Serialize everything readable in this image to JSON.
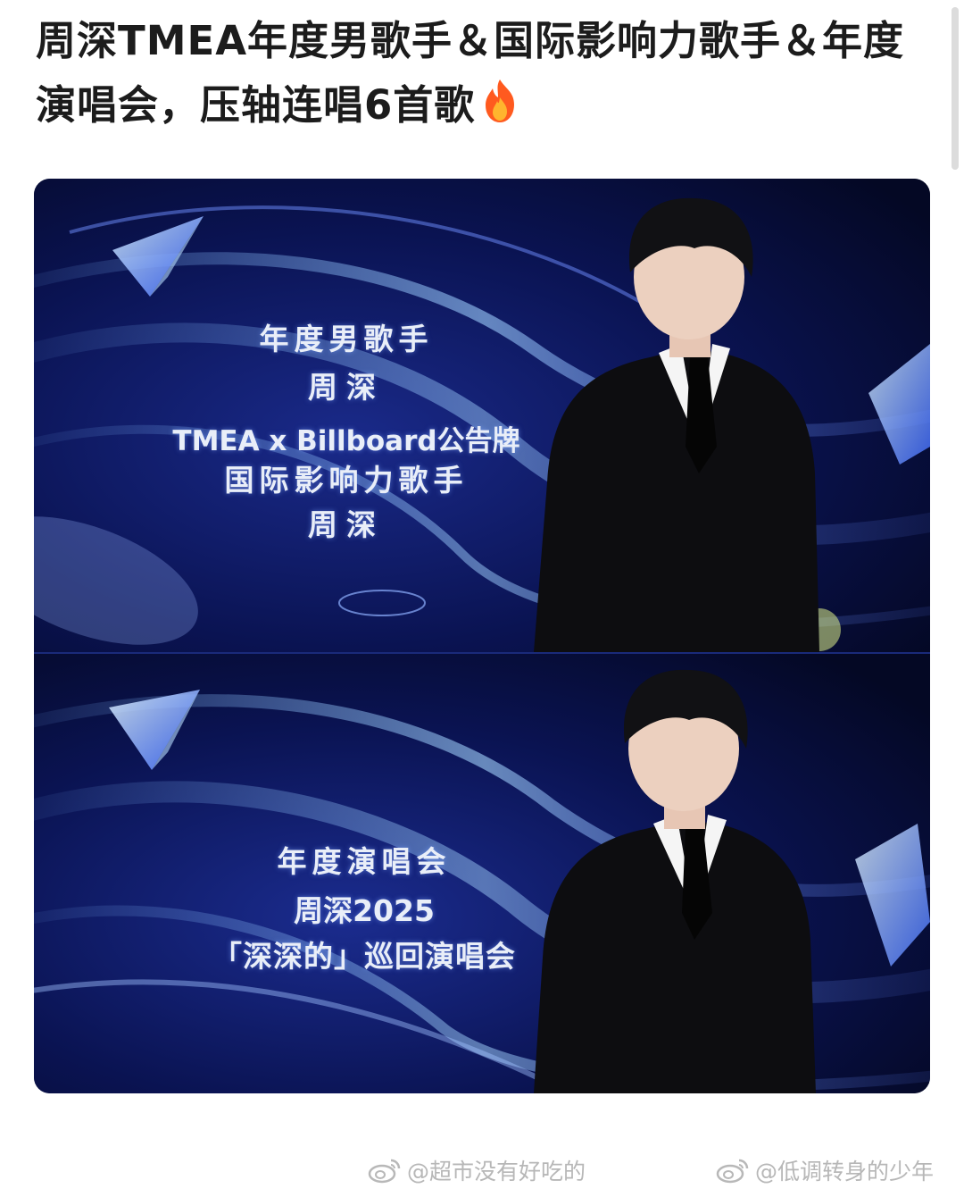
{
  "post": {
    "title": "周深TMEA年度男歌手＆国际影响力歌手＆年度演唱会，压轴连唱6首歌",
    "emoji": "fire-icon"
  },
  "panel_1": {
    "award_1_category": "年度男歌手",
    "award_1_name": "周深",
    "award_2_sponsor": "TMEA x Billboard公告牌",
    "award_2_category": "国际影响力歌手",
    "award_2_name": "周深"
  },
  "panel_2": {
    "award_category": "年度演唱会",
    "concert_line_1": "周深2025",
    "concert_line_2": "「深深的」巡回演唱会"
  },
  "watermarks": {
    "left": "@超市没有好吃的",
    "right": "@低调转身的少年"
  },
  "colors": {
    "stage_background": "#0b1450",
    "accent_blue": "#3a6cff",
    "suit": "#0d0d10"
  }
}
